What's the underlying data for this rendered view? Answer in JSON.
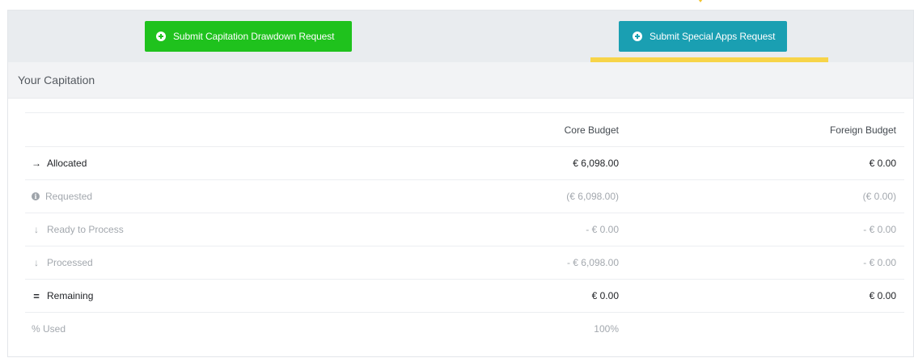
{
  "toolbar": {
    "drawdown_button_label": "Submit Capitation Drawdown Request",
    "special_apps_button_label": "Submit Special Apps Request"
  },
  "section": {
    "title": "Your Capitation"
  },
  "table": {
    "columns": [
      "",
      "Core Budget",
      "Foreign Budget"
    ],
    "rows": [
      {
        "label": "Allocated",
        "icon": "arrow-right-icon",
        "core": "€ 6,098.00",
        "foreign": "€ 0.00"
      },
      {
        "label": "Requested",
        "icon": "info-icon",
        "core": "(€ 6,098.00)",
        "foreign": "(€ 0.00)"
      },
      {
        "label": "Ready to Process",
        "icon": "arrow-down-icon",
        "core": "- € 0.00",
        "foreign": "- € 0.00"
      },
      {
        "label": "Processed",
        "icon": "arrow-down-icon",
        "core": "- € 6,098.00",
        "foreign": "- € 0.00"
      },
      {
        "label": "Remaining",
        "icon": "equals-icon",
        "core": "€ 0.00",
        "foreign": "€ 0.00"
      },
      {
        "label": "% Used",
        "icon": "",
        "core": "100%",
        "foreign": ""
      }
    ]
  },
  "colors": {
    "green_button": "#1fc21d",
    "teal_button": "#1a9fb2",
    "highlight": "#f7d449"
  }
}
